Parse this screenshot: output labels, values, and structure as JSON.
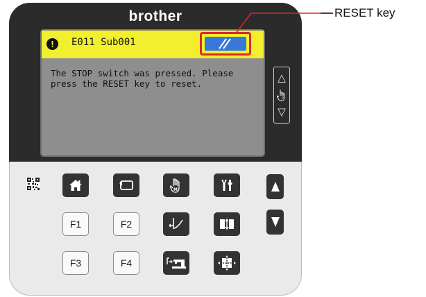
{
  "panel": {
    "brand": "brother"
  },
  "screen": {
    "error_code": "E011 Sub001",
    "message_lines": [
      "The STOP switch was pressed. Please",
      "press the RESET key to reset."
    ]
  },
  "callout": {
    "label": "RESET key"
  },
  "function_keys": {
    "f1": "F1",
    "f2": "F2",
    "f3": "F3",
    "f4": "F4"
  },
  "icons": {
    "alert": "exclamation-icon",
    "reset": "reset-icon",
    "home": "home-icon",
    "back": "return-icon",
    "manual": "manual-hand-icon",
    "tools": "tools-icon",
    "thread": "thread-trim-icon",
    "split": "split-icon",
    "machine": "sewing-machine-icon",
    "move": "move-icon",
    "up": "triangle-up-icon",
    "down": "triangle-down-icon"
  },
  "colors": {
    "error_bar": "#f2ef2f",
    "reset_button": "#3878d8",
    "highlight": "#e0262a",
    "panel_dark": "#2b2b2b",
    "screen": "#8e8e8e"
  }
}
